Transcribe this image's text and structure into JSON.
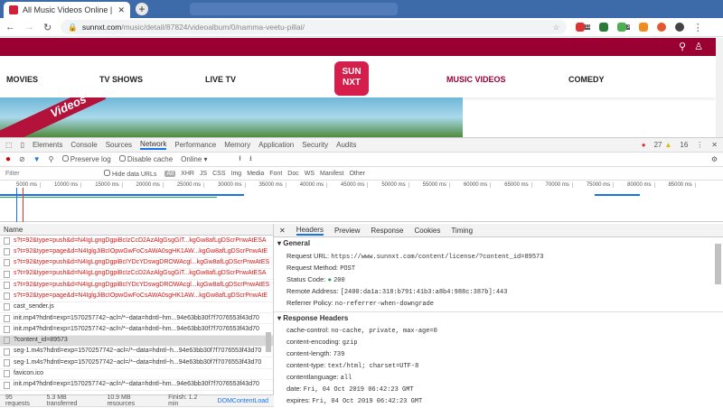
{
  "browser": {
    "tab_title": "All Music Videos Online | Online",
    "new_tab": "+",
    "url_host": "sunnxt.com",
    "url_path": "/music/detail/87824/videoalbum/0/namma-veetu-pillai/",
    "ext_badges": [
      "11",
      "3"
    ]
  },
  "site": {
    "nav": [
      "MOVIES",
      "TV SHOWS",
      "LIVE TV",
      "MUSIC VIDEOS",
      "COMEDY"
    ],
    "logo": "SUN NXT",
    "banner_label": "Videos",
    "accent": "#9b0033"
  },
  "devtools": {
    "tabs": [
      "Elements",
      "Console",
      "Sources",
      "Network",
      "Performance",
      "Memory",
      "Application",
      "Security",
      "Audits"
    ],
    "errors": "27",
    "warnings": "16",
    "toolbar": {
      "preserve_log": "Preserve log",
      "disable_cache": "Disable cache",
      "throttle": "Online"
    },
    "filter": {
      "placeholder": "Filter",
      "hide_data": "Hide data URLs",
      "types": [
        "All",
        "XHR",
        "JS",
        "CSS",
        "Img",
        "Media",
        "Font",
        "Doc",
        "WS",
        "Manifest",
        "Other"
      ]
    },
    "timeline_ticks": [
      "5000 ms",
      "10000 ms",
      "15000 ms",
      "20000 ms",
      "25000 ms",
      "30000 ms",
      "35000 ms",
      "40000 ms",
      "45000 ms",
      "50000 ms",
      "55000 ms",
      "60000 ms",
      "65000 ms",
      "70000 ms",
      "75000 ms",
      "80000 ms",
      "85000 ms"
    ],
    "name_header": "Name",
    "requests": [
      {
        "name": "s?t=92&type=push&d=N4IgLgngDgpiBcIzCcD2AzAlgGsgGiT...kgGw8afLgDScrPnwAtESA",
        "err": true
      },
      {
        "name": "s?t=92&type=page&d=N4IglgJiBcIOpwGwFoCsAWA0sgHK1AW...kgGw8afLgDScrPnwAtE",
        "err": true
      },
      {
        "name": "s?t=92&type=push&d=N4IgLgngDgpiBcIYDcYDswgDROWAcgl...kgGw8afLgDScrPnwAtES",
        "err": true
      },
      {
        "name": "s?t=92&type=push&d=N4IgLgngDgpiBcIzCcD2AzAlgGsgGiT...kgGw8afLgDScrPnwAtESA",
        "err": true
      },
      {
        "name": "s?t=92&type=push&d=N4IgLgngDgpiBcIYDcYDswgDROWAcgl...kgGw8afLgDScrPnwAtES",
        "err": true
      },
      {
        "name": "s?t=92&type=page&d=N4IglgJiBcIOpwGwFoCsAWA0sgHK1AW...kgGw8afLgDScrPnwAtE",
        "err": true
      },
      {
        "name": "cast_sender.js",
        "err": false
      },
      {
        "name": "init.mp4?hdntl=exp=1570257742~acl=/*~data=hdntl~hm...94e63bb30f7f7076553f43d70",
        "err": false
      },
      {
        "name": "init.mp4?hdntl=exp=1570257742~acl=/*~data=hdntl~hm...94e63bb30f7f7076553f43d70",
        "err": false
      },
      {
        "name": "?content_id=89573",
        "err": false,
        "selected": true
      },
      {
        "name": "seg-1.m4s?hdntl=exp=1570257742~acl=/*~data=hdntl~h...94e63bb30f7f7076553f43d70",
        "err": false
      },
      {
        "name": "seg-1.m4s?hdntl=exp=1570257742~acl=/*~data=hdntl~h...94e63bb30f7f7076553f43d70",
        "err": false
      },
      {
        "name": "favicon.ico",
        "err": false
      },
      {
        "name": "init.mp4?hdntl=exp=1570257742~acl=/*~data=hdntl~hm...94e63bb30f7f7076553f43d70",
        "err": false
      }
    ],
    "status": [
      "95 requests",
      "5.3 MB transferred",
      "10.9 MB resources",
      "Finish: 1.2 min",
      "DOMContentLoad"
    ],
    "detail_tabs": [
      "Headers",
      "Preview",
      "Response",
      "Cookies",
      "Timing"
    ],
    "general": {
      "title": "General",
      "rows": [
        {
          "k": "Request URL:",
          "v": "https://www.sunnxt.com/content/license/?content_id=89573"
        },
        {
          "k": "Request Method:",
          "v": "POST"
        },
        {
          "k": "Status Code:",
          "v": "200"
        },
        {
          "k": "Remote Address:",
          "v": "[2400:da1a:318:b791:41b3:a8b4:988c:387b]:443"
        },
        {
          "k": "Referrer Policy:",
          "v": "no-referrer-when-downgrade"
        }
      ]
    },
    "response_headers": {
      "title": "Response Headers",
      "rows": [
        {
          "k": "cache-control:",
          "v": "no-cache, private, max-age=0"
        },
        {
          "k": "content-encoding:",
          "v": "gzip"
        },
        {
          "k": "content-length:",
          "v": "739"
        },
        {
          "k": "content-type:",
          "v": "text/html; charset=UTF-8"
        },
        {
          "k": "contentlanguage:",
          "v": "all"
        },
        {
          "k": "date:",
          "v": "Fri, 04 Oct 2019 06:42:23 GMT"
        },
        {
          "k": "expires:",
          "v": "Fri, 04 Oct 2019 06:42:23 GMT"
        }
      ]
    }
  }
}
